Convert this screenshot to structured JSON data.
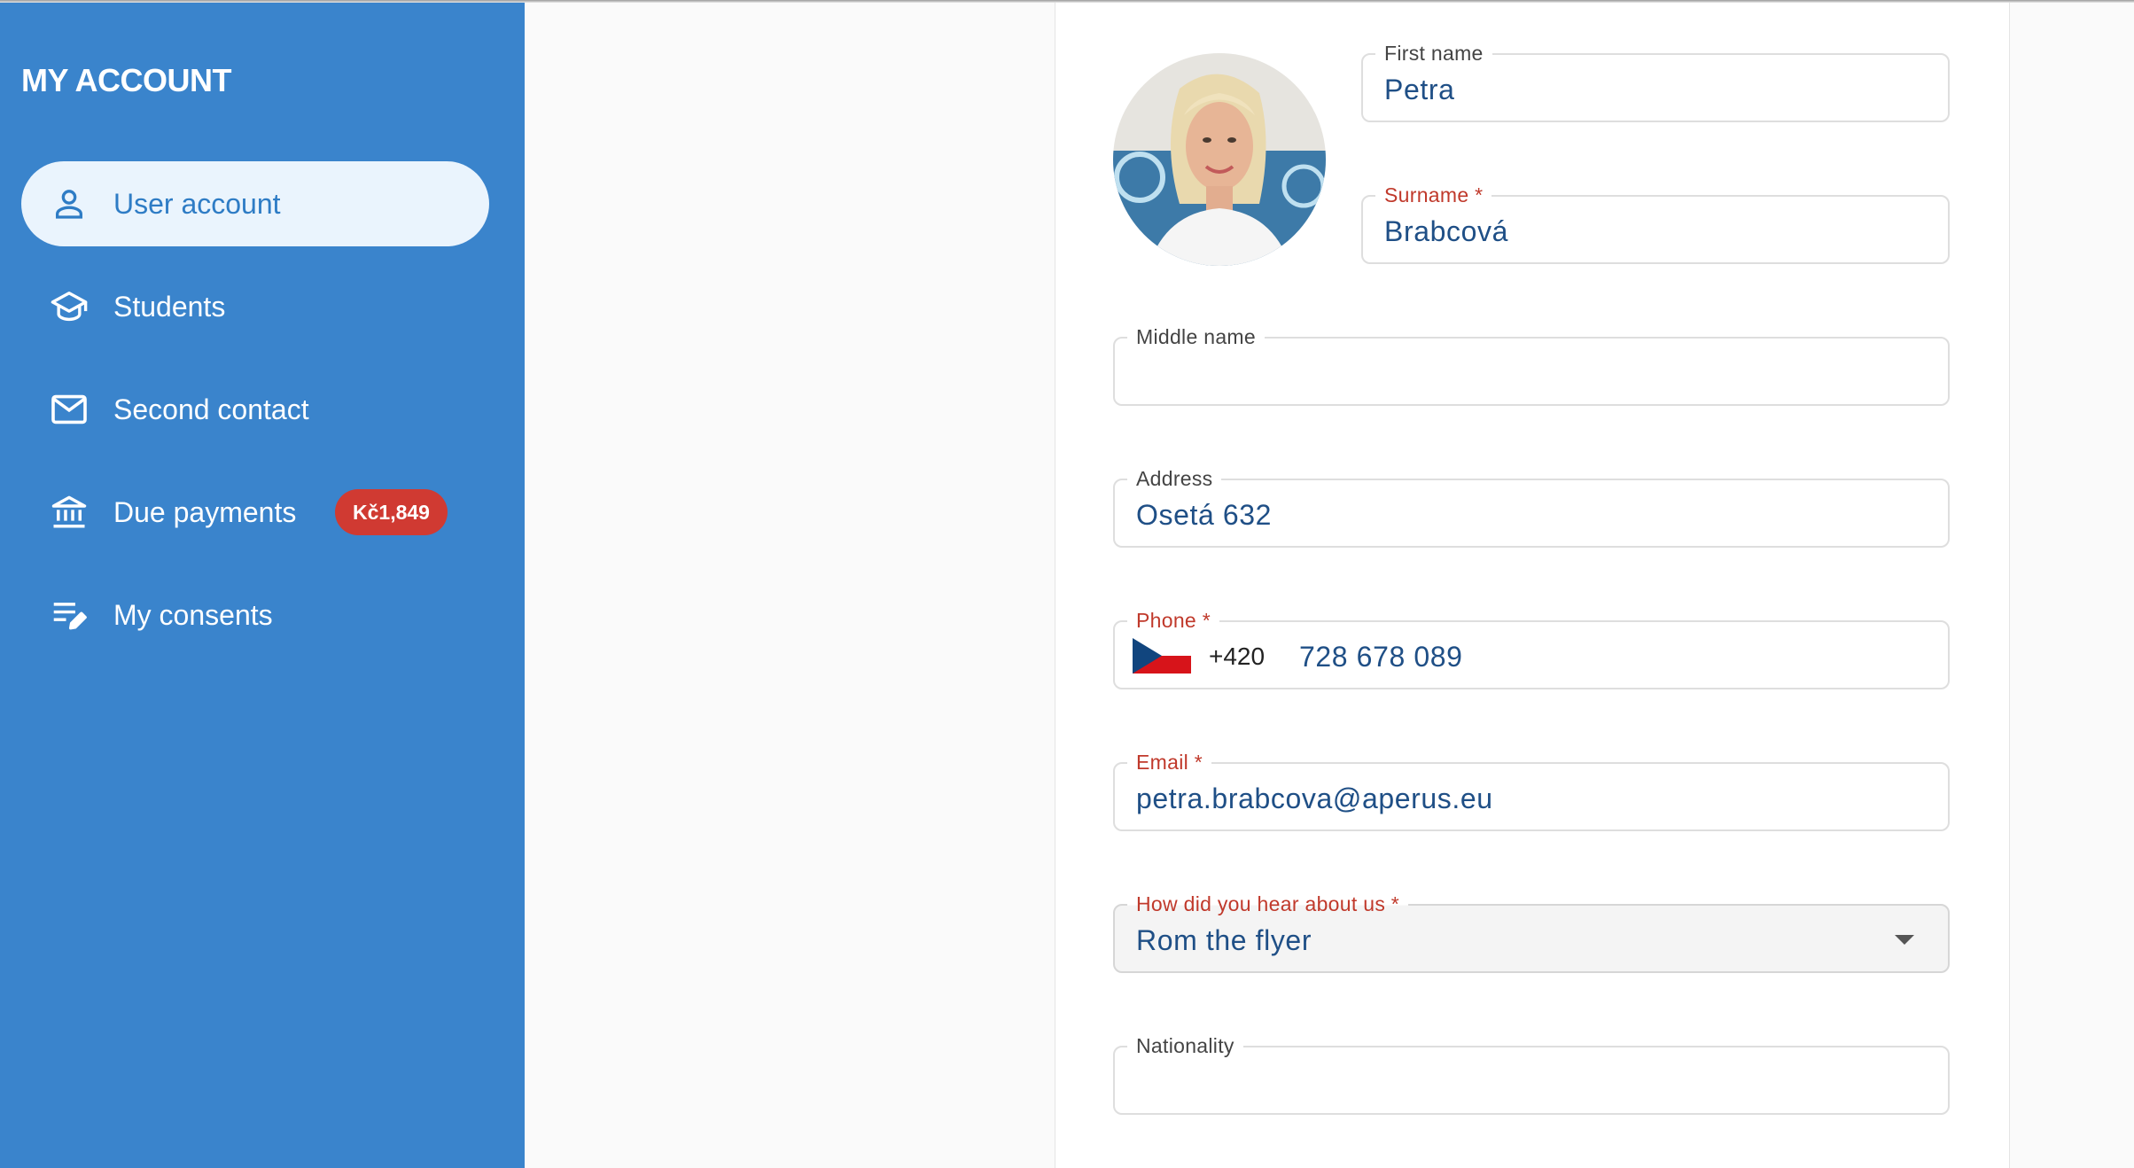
{
  "sidebar": {
    "title": "MY ACCOUNT",
    "items": [
      {
        "label": "User account",
        "icon": "person-icon",
        "active": true
      },
      {
        "label": "Students",
        "icon": "graduation-cap-icon"
      },
      {
        "label": "Second contact",
        "icon": "mail-icon"
      },
      {
        "label": "Due payments",
        "icon": "bank-icon",
        "badge": "Kč1,849"
      },
      {
        "label": "My consents",
        "icon": "edit-note-icon"
      }
    ]
  },
  "form": {
    "first_name": {
      "label": "First name",
      "value": "Petra"
    },
    "surname": {
      "label": "Surname *",
      "value": "Brabcová"
    },
    "middle_name": {
      "label": "Middle name",
      "value": ""
    },
    "address": {
      "label": "Address",
      "value": "Osetá 632"
    },
    "phone": {
      "label": "Phone *",
      "dial_code": "+420",
      "value": "728 678 089",
      "flag": "czech-flag-icon"
    },
    "email": {
      "label": "Email *",
      "value": "petra.brabcova@aperus.eu"
    },
    "referral": {
      "label": "How did you hear about us *",
      "value": "Rom the flyer"
    },
    "nationality": {
      "label": "Nationality",
      "value": ""
    }
  },
  "colors": {
    "sidebar": "#3a84cc",
    "active_item_bg": "#eaf4fd",
    "badge": "#d03a32",
    "required_label": "#c0392b",
    "value_text": "#1f4f86"
  }
}
